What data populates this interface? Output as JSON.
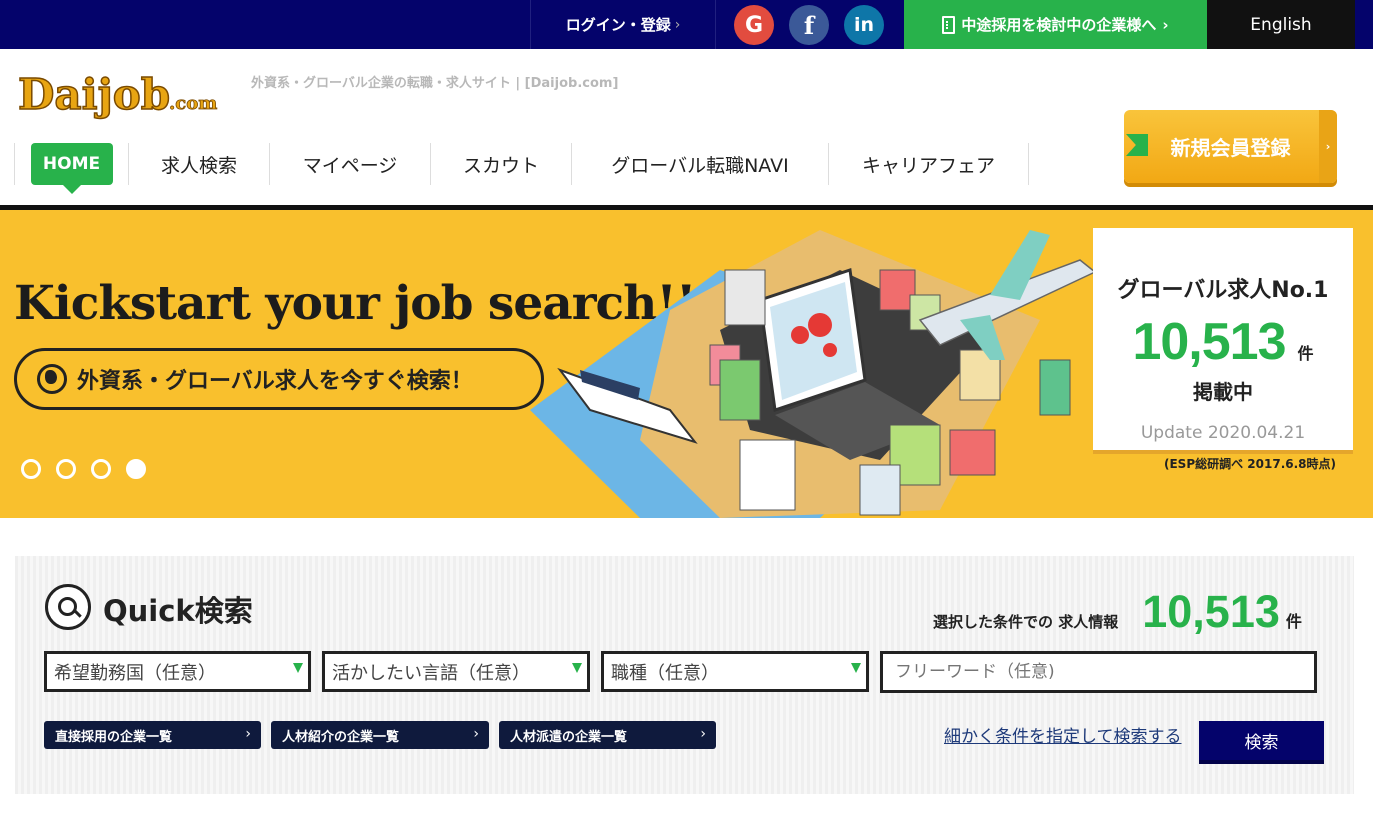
{
  "topbar": {
    "login_label": "ログイン・登録",
    "login_chevron": "›",
    "google": "G",
    "facebook": "f",
    "linkedin": "in",
    "business_label": "中途採用を検討中の企業様へ",
    "business_chevron": "›",
    "english_label": "English"
  },
  "header": {
    "logo_text": "Daijob",
    "logo_suffix": ".com",
    "tagline": "外資系・グローバル企業の転職・求人サイト | [Daijob.com]",
    "register_label": "新規会員登録",
    "register_arrow": "›"
  },
  "nav": {
    "home": "HOME",
    "items": [
      "求人検索",
      "マイページ",
      "スカウト",
      "グローバル転職NAVI",
      "キャリアフェア"
    ]
  },
  "hero": {
    "headline": "Kickstart your job search!!",
    "pill_text": "外資系・グローバル求人を今すぐ検索！",
    "stat_title": "グローバル求人No.1",
    "stat_number": "10,513",
    "stat_unit": "件",
    "stat_sub": "掲載中",
    "update_text": "Update 2020.04.21",
    "note": "(ESP総研調べ 2017.6.8時点)",
    "slides": 4,
    "active_slide": 4
  },
  "quick_search": {
    "title": "Quick検索",
    "count_label": "選択した条件での 求人情報",
    "count": "10,513",
    "count_unit": "件",
    "selects": [
      "希望勤務国（任意）",
      "活かしたい言語（任意）",
      "職種（任意）"
    ],
    "freeword_placeholder": "フリーワード（任意)",
    "categories": [
      "直接採用の企業一覧",
      "人材紹介の企業一覧",
      "人材派遣の企業一覧"
    ],
    "category_chevron": "›",
    "detail_link": "細かく条件を指定して検索する",
    "search_button": "検索"
  },
  "colors": {
    "navy": "#04036b",
    "green": "#28b24b",
    "yellow": "#f9c02d",
    "orange_button": "#f2a814"
  }
}
